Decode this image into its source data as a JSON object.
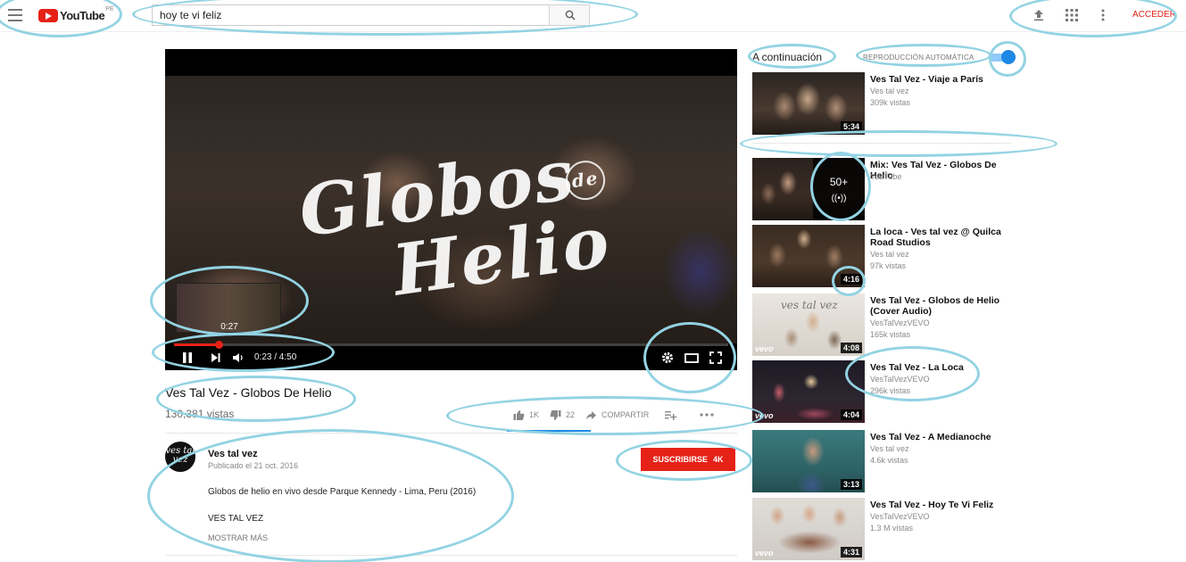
{
  "header": {
    "logo_text": "YouTube",
    "country": "PE",
    "search_value": "hoy te vi feliz",
    "login_label": "ACCEDER",
    "accent_color": "#e62117"
  },
  "player": {
    "title_overlay_line1": "Globos",
    "title_overlay_de": "de",
    "title_overlay_line2": "Helio",
    "preview_time": "0:27",
    "current_time": "0:23 / 4:50",
    "progress": 0.08
  },
  "video": {
    "title": "Ves Tal Vez - Globos De Helio",
    "views": "130,381 vistas",
    "likes": "1K",
    "dislikes": "22",
    "share_label": "COMPARTIR",
    "channel": "Ves tal vez",
    "avatar_text": "ves tal vez",
    "published": "Publicado el 21 oct. 2016",
    "subscribe_label": "SUSCRIBIRSE",
    "subscriber_count": "4K",
    "description": "Globos de helio en vivo desde Parque Kennedy - Lima, Peru (2016)",
    "description_line2": "VES TAL VEZ",
    "show_more": "MOSTRAR MÁS"
  },
  "sidebar": {
    "up_next": "A continuación",
    "autoplay_label": "REPRODUCCIÓN AUTOMÁTICA",
    "autoplay_on": true,
    "videos": [
      {
        "title": "Ves Tal Vez - Viaje a París",
        "channel": "Ves tal vez",
        "views": "309k vistas",
        "duration": "5:34"
      },
      {
        "title": "Mix: Ves Tal Vez - Globos De Helio",
        "channel": "YouTube",
        "views": "",
        "duration": "",
        "mix_count": "50+"
      },
      {
        "title": "La loca - Ves tal vez @ Quilca Road Studios",
        "channel": "Ves tal vez",
        "views": "97k vistas",
        "duration": "4:16"
      },
      {
        "title": "Ves Tal Vez - Globos de Helio (Cover Audio)",
        "channel": "VesTalVezVEVO",
        "views": "165k vistas",
        "duration": "4:08"
      },
      {
        "title": "Ves Tal Vez - La Loca",
        "channel": "VesTalVezVEVO",
        "views": "296k vistas",
        "duration": "4:04"
      },
      {
        "title": "Ves Tal Vez - A Medianoche",
        "channel": "Ves tal vez",
        "views": "4.6k vistas",
        "duration": "3:13"
      },
      {
        "title": "Ves Tal Vez - Hoy Te Vi Feliz",
        "channel": "VesTalVezVEVO",
        "views": "1.3 M vistas",
        "duration": "4:31"
      }
    ],
    "vevo_label": "vevo",
    "thumb3_text": "ves tal vez"
  }
}
